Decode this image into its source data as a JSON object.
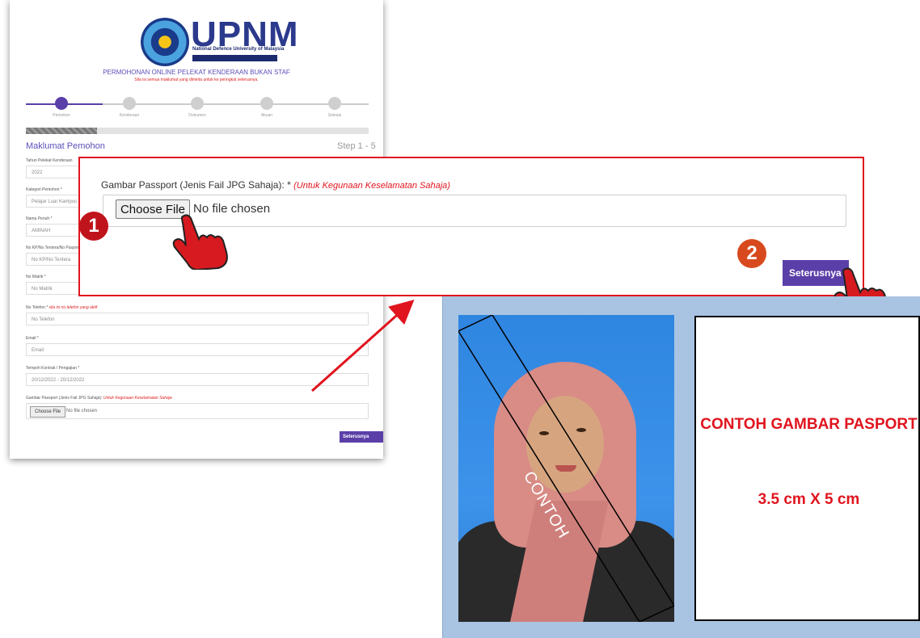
{
  "form": {
    "brand": "UPNM",
    "brand_tagline": "National Defence University of Malaysia",
    "title": "PERMOHONAN ONLINE PELEKAT KENDERAAN BUKAN STAF",
    "subtitle": "Sila isi semua maklumat yang diminta untuk ke peringkat seterusnya.",
    "steps": [
      "Pemohon",
      "Kenderaan",
      "Dokumen",
      "Akuan",
      "Selesai"
    ],
    "section_title": "Maklumat Pemohon",
    "step_counter": "Step 1 - 5",
    "fields": [
      {
        "label": "Tahun Pelekat Kenderaan",
        "value": "2022"
      },
      {
        "label": "Kategori Pemohon *",
        "value": "Pelajar Luar Kampus"
      },
      {
        "label": "Nama Penuh *",
        "value": "AMINAH"
      },
      {
        "label": "No KP/No Tentera/No Pasport *",
        "value": "No KP/No Tentera"
      },
      {
        "label": "No Matrik *",
        "value": "No Matrik"
      },
      {
        "label": "No Telefon *",
        "note": "sila isi no telefon yang aktif",
        "value": "No Telefon"
      },
      {
        "label": "Email *",
        "value": "Email"
      },
      {
        "label": "Tempoh Kontrak / Pengajian *",
        "value": "20/12/2022 - 20/12/2022"
      }
    ],
    "passport_label": "Gambar Passport (Jenis Fail JPG Sahaja):",
    "passport_note": "Untuk Kegunaan Keselamatan Sahaja",
    "choose_file": "Choose File",
    "no_file": "No file chosen",
    "next_label": "Seterusnya"
  },
  "zoom": {
    "label": "Gambar Passport (Jenis Fail JPG Sahaja): *",
    "note": "(Untuk Kegunaan Keselamatan Sahaja)",
    "choose_file": "Choose File",
    "no_file": "No file chosen",
    "next_label": "Seterusnya"
  },
  "badges": {
    "one": "1",
    "two": "2"
  },
  "sample": {
    "watermark": "CONTOH",
    "title": "CONTOH GAMBAR PASPORT",
    "size": "3.5 cm X 5 cm"
  },
  "colors": {
    "accent": "#5b3fa8",
    "highlight_red": "#e0141e",
    "sample_bg": "#a9c4e3"
  },
  "icons": [
    "pointing-hand-icon",
    "user-icon",
    "car-icon",
    "document-icon",
    "check-icon"
  ]
}
